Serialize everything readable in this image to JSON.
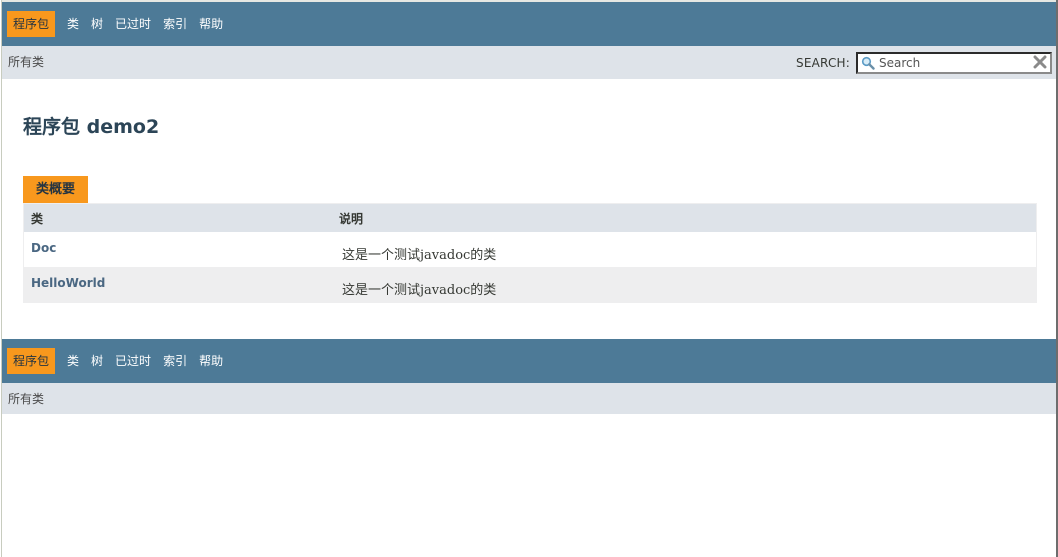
{
  "top_nav": {
    "items": [
      {
        "label": "程序包",
        "active": true
      },
      {
        "label": "类",
        "active": false
      },
      {
        "label": "树",
        "active": false
      },
      {
        "label": "已过时",
        "active": false
      },
      {
        "label": "索引",
        "active": false
      },
      {
        "label": "帮助",
        "active": false
      }
    ],
    "all_classes": "所有类",
    "search": {
      "label": "SEARCH:",
      "placeholder": "Search",
      "value": ""
    }
  },
  "header": {
    "title": "程序包 demo2"
  },
  "class_summary": {
    "caption": "类概要",
    "columns": [
      "类",
      "说明"
    ],
    "rows": [
      {
        "name": "Doc",
        "description": "这是一个测试javadoc的类"
      },
      {
        "name": "HelloWorld",
        "description": "这是一个测试javadoc的类"
      }
    ]
  },
  "bottom_nav": {
    "items": [
      {
        "label": "程序包",
        "active": true
      },
      {
        "label": "类",
        "active": false
      },
      {
        "label": "树",
        "active": false
      },
      {
        "label": "已过时",
        "active": false
      },
      {
        "label": "索引",
        "active": false
      },
      {
        "label": "帮助",
        "active": false
      }
    ],
    "all_classes": "所有类"
  },
  "colors": {
    "navbar": "#4d7a97",
    "active_tab": "#f8981d",
    "subnav": "#dee3e9",
    "link": "#4a6782",
    "title": "#2c4557"
  }
}
